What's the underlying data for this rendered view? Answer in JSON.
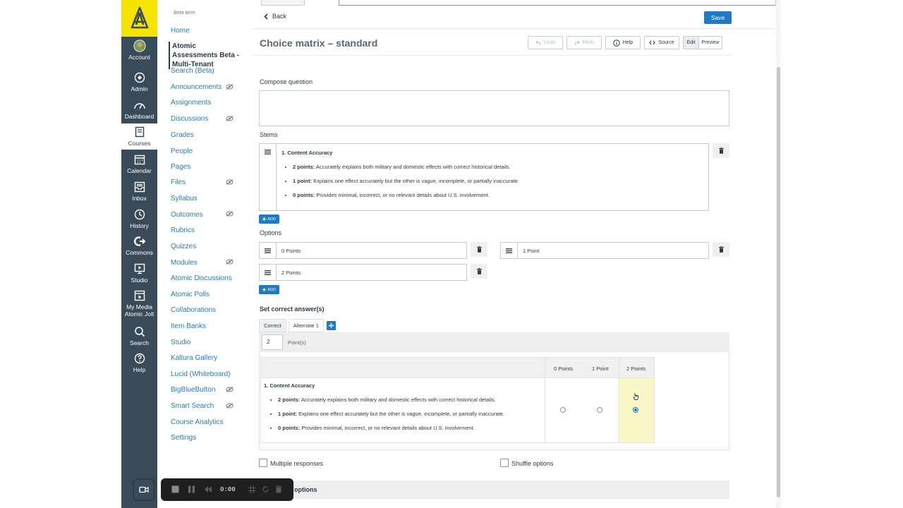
{
  "global_nav": [
    {
      "label": "Account",
      "icon": "avatar-icon"
    },
    {
      "label": "Admin",
      "icon": "shield-icon"
    },
    {
      "label": "Dashboard",
      "icon": "gauge-icon"
    },
    {
      "label": "Courses",
      "icon": "book-icon"
    },
    {
      "label": "Calendar",
      "icon": "calendar-icon"
    },
    {
      "label": "Inbox",
      "icon": "inbox-icon"
    },
    {
      "label": "History",
      "icon": "clock-icon"
    },
    {
      "label": "Commons",
      "icon": "commons-icon"
    },
    {
      "label": "Studio",
      "icon": "studio-icon"
    },
    {
      "label": "My Media Atomic Jolt",
      "icon": "media-icon"
    },
    {
      "label": "Search",
      "icon": "search-icon"
    },
    {
      "label": "Help",
      "icon": "help-icon"
    }
  ],
  "course_nav": {
    "term": "Beta term",
    "items": [
      "Home",
      "Atomic Assessments Beta - Multi-Tenant",
      "Search (Beta)",
      "Announcements",
      "Assignments",
      "Discussions",
      "Grades",
      "People",
      "Pages",
      "Files",
      "Syllabus",
      "Outcomes",
      "Rubrics",
      "Quizzes",
      "Modules",
      "Atomic Discussions",
      "Atomic Polls",
      "Collaborations",
      "Item Banks",
      "Studio",
      "Kaltura Gallery",
      "Lucid (Whiteboard)",
      "BigBlueButton",
      "Smart Search",
      "Course Analytics",
      "Settings"
    ]
  },
  "editor": {
    "back_label": "Back",
    "save_label": "Save",
    "title": "Choice matrix – standard",
    "toolbar": {
      "undo": "Undo",
      "redo": "Redo",
      "help": "Help",
      "source": "Source",
      "edit": "Edit",
      "preview": "Preview"
    },
    "compose_label": "Compose question",
    "stems_label": "Stems",
    "stem": {
      "heading": "1. Content Accuracy",
      "bullets": [
        {
          "bold": "2 points:",
          "text": " Accurately explains both military and domestic effects with correct historical details."
        },
        {
          "bold": "1 point:",
          "text": " Explains one effect accurately but the other is vague, incomplete, or partially inaccurate."
        },
        {
          "bold": "0 points:",
          "text": " Provides minimal, incorrect, or no relevant details about U.S. involvement."
        }
      ]
    },
    "add_label": "ADD",
    "options_label": "Options",
    "options": [
      "0 Points",
      "1 Point",
      "2 Points"
    ],
    "correct_label": "Set correct answer(s)",
    "answer_tabs": [
      "Correct",
      "Alternate 1"
    ],
    "points_value": "2",
    "points_label": "Point(s)",
    "matrix_columns": [
      "0 Points",
      "1 Point",
      "2 Points"
    ],
    "selected_column": 2,
    "multiple_responses": "Multiple responses",
    "shuffle_options": "Shuffle options",
    "more_options": "options"
  },
  "recorder": {
    "time": "0:00"
  },
  "colors": {
    "accent": "#1f7ac1",
    "nav_bg": "#394b58",
    "logo_bg": "#f5e400",
    "highlight": "#fbf8c8"
  }
}
